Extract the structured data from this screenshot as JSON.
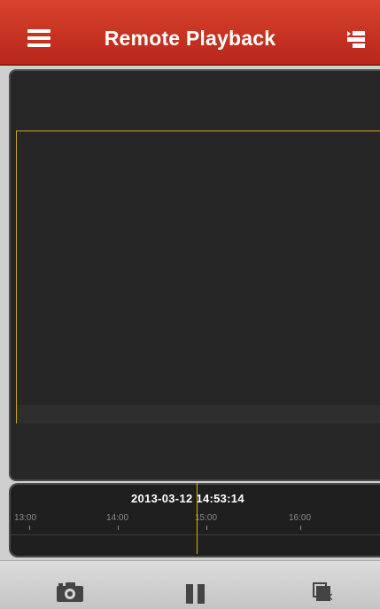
{
  "header": {
    "title": "Remote Playback",
    "menu_icon": "hamburger-menu-icon",
    "list_icon": "playback-list-icon",
    "color": "#c73322"
  },
  "video": {
    "selected_border_color": "#d1a321"
  },
  "timeline": {
    "datetime": "2013-03-12 14:53:14",
    "ticks": [
      "13:00",
      "14:00",
      "15:00",
      "16:00"
    ],
    "cursor_color": "#e0b000"
  },
  "toolbar": {
    "capture_icon": "camera-icon",
    "pause_icon": "pause-icon",
    "close_icon": "close-all-windows-icon"
  }
}
